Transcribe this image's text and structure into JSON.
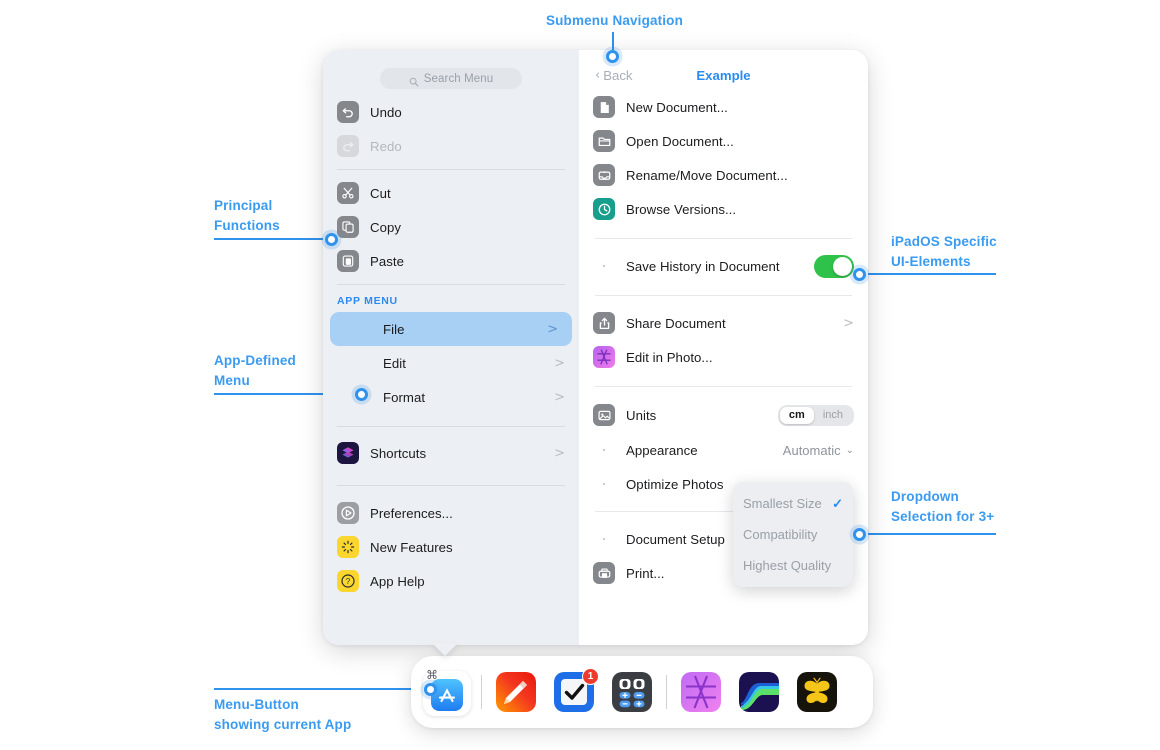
{
  "annotations": [
    {
      "id": "submenu-navigation",
      "text_lines": [
        "Submenu Navigation"
      ]
    },
    {
      "id": "principal-functions",
      "text_lines": [
        "Principal",
        "Functions"
      ]
    },
    {
      "id": "app-defined-menu",
      "text_lines": [
        "App-Defined",
        "Menu"
      ]
    },
    {
      "id": "ipados-specific",
      "text_lines": [
        "iPadOS Specific",
        "UI-Elements"
      ]
    },
    {
      "id": "dropdown-selection",
      "text_lines": [
        "Dropdown",
        "Selection for 3+"
      ]
    },
    {
      "id": "menu-button",
      "text_lines": [
        "Menu-Button",
        "showing current App"
      ]
    }
  ],
  "accent_color": "#2f92ed",
  "menu": {
    "search": {
      "placeholder": "Search Menu",
      "value": "",
      "icon": "search-icon"
    },
    "primary_items": [
      {
        "label": "Undo",
        "icon": "undo-icon",
        "enabled": true,
        "icon_style": "dark"
      },
      {
        "label": "Redo",
        "icon": "redo-icon",
        "enabled": false,
        "icon_style": "light"
      }
    ],
    "edit_items": [
      {
        "label": "Cut",
        "icon": "scissors-icon",
        "enabled": true,
        "icon_style": "dark"
      },
      {
        "label": "Copy",
        "icon": "copy-icon",
        "enabled": true,
        "icon_style": "dark"
      },
      {
        "label": "Paste",
        "icon": "paste-icon",
        "enabled": true,
        "icon_style": "dark"
      }
    ],
    "app_menu_title": "APP MENU",
    "app_menu_items": [
      {
        "label": "File",
        "selected": true,
        "chevron": ">"
      },
      {
        "label": "Edit",
        "selected": false,
        "chevron": ">"
      },
      {
        "label": "Format",
        "selected": false,
        "chevron": ">"
      }
    ],
    "shortcuts_item": {
      "label": "Shortcuts",
      "icon": "shortcuts-icon",
      "chevron": ">"
    },
    "footer_items": [
      {
        "label": "Preferences...",
        "icon": "preferences-icon",
        "icon_style": "gray2"
      },
      {
        "label": "New Features",
        "icon": "sparkle-icon",
        "icon_style": "yellow"
      },
      {
        "label": "App Help",
        "icon": "question-icon",
        "icon_style": "yellow"
      }
    ]
  },
  "submenu": {
    "back_label": "Back",
    "back_chevron": "‹",
    "title": "Example",
    "document_items": [
      {
        "label": "New Document...",
        "icon": "document-icon",
        "icon_style": "dark"
      },
      {
        "label": "Open Document...",
        "icon": "folder-icon",
        "icon_style": "dark"
      },
      {
        "label": "Rename/Move Document...",
        "icon": "tray-icon",
        "icon_style": "dark"
      },
      {
        "label": "Browse Versions...",
        "icon": "clock-history-icon",
        "icon_style": "teal"
      }
    ],
    "save_history": {
      "label": "Save History in Document",
      "toggle_on": true
    },
    "share_items": [
      {
        "label": "Share Document",
        "icon": "share-icon",
        "icon_style": "dark",
        "chevron": ">"
      },
      {
        "label": "Edit in Photo...",
        "icon": "photo-app-icon",
        "icon_style": "purple",
        "chevron": ""
      }
    ],
    "units": {
      "label": "Units",
      "icon": "units-icon",
      "options": [
        "cm",
        "inch"
      ],
      "selected": "cm"
    },
    "appearance": {
      "label": "Appearance",
      "value": "Automatic",
      "chevron": "⌄"
    },
    "optimize_photos": {
      "label": "Optimize Photos"
    },
    "document_setup": {
      "label": "Document Setup"
    },
    "print": {
      "label": "Print...",
      "icon": "printer-icon",
      "icon_style": "dark"
    },
    "dropdown": {
      "items": [
        {
          "label": "Smallest Size",
          "checked": true
        },
        {
          "label": "Compatibility",
          "checked": false
        },
        {
          "label": "Highest Quality",
          "checked": false
        }
      ],
      "check_glyph": "✓"
    }
  },
  "dock": {
    "command_glyph": "⌘",
    "items": [
      {
        "name": "current-app",
        "icon": "app-store-icon",
        "current": true,
        "badge": ""
      },
      {
        "name": "divider-1",
        "icon": "divider",
        "current": false,
        "badge": ""
      },
      {
        "name": "app-pages",
        "icon": "pages-icon",
        "current": false,
        "badge": ""
      },
      {
        "name": "app-things",
        "icon": "checkbox-icon",
        "current": false,
        "badge": "1"
      },
      {
        "name": "app-calc",
        "icon": "calculator-icon",
        "current": false,
        "badge": ""
      },
      {
        "name": "divider-2",
        "icon": "divider",
        "current": false,
        "badge": ""
      },
      {
        "name": "app-affinity-photo",
        "icon": "aperture-icon",
        "current": false,
        "badge": ""
      },
      {
        "name": "app-affinity-designer",
        "icon": "curve-icon",
        "current": false,
        "badge": ""
      },
      {
        "name": "app-ulysses",
        "icon": "butterfly-icon",
        "current": false,
        "badge": ""
      }
    ]
  }
}
